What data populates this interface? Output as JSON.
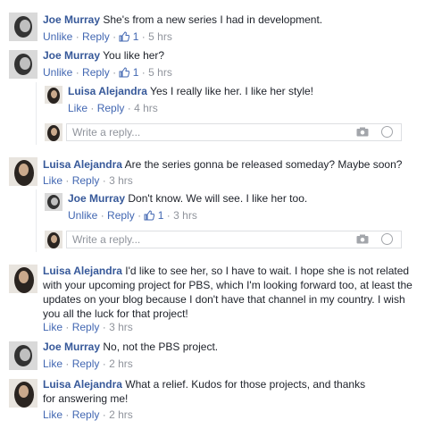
{
  "comments": [
    {
      "author": "Joe Murray",
      "text": "She's from a new series I had in development.",
      "unlike": "Unlike",
      "reply": "Reply",
      "likes": "1",
      "time": "5 hrs"
    },
    {
      "author": "Joe Murray",
      "text": "You like her?",
      "unlike": "Unlike",
      "reply": "Reply",
      "likes": "1",
      "time": "5 hrs"
    },
    {
      "author": "Luisa Alejandra",
      "text": "Yes I really like her. I like her style!",
      "like": "Like",
      "reply": "Reply",
      "time": "4 hrs"
    },
    {
      "author": "Luisa Alejandra",
      "text": "Are the series gonna be released someday? Maybe soon?",
      "like": "Like",
      "reply": "Reply",
      "time": "3 hrs"
    },
    {
      "author": "Joe Murray",
      "text": "Don't know. We will see. I like her too.",
      "unlike": "Unlike",
      "reply": "Reply",
      "likes": "1",
      "time": "3 hrs"
    },
    {
      "author": "Luisa Alejandra",
      "text": "I'd like to see her, so I have to wait. I hope she is not related with your upcoming project for PBS, which I'm looking forward too, at least the updates on your blog because I don't have that channel in my country. I wish you all the luck for that project!",
      "like": "Like",
      "reply": "Reply",
      "time": "3 hrs"
    },
    {
      "author": "Joe Murray",
      "text": "No, not the PBS project.",
      "like": "Like",
      "reply": "Reply",
      "time": "2 hrs"
    },
    {
      "author": "Luisa Alejandra",
      "text": "What a relief. Kudos for those projects, and thanks for answering me!",
      "like": "Like",
      "reply": "Reply",
      "time": "2 hrs"
    }
  ],
  "reply_box": {
    "placeholder": "Write a reply..."
  },
  "icons": {
    "like": "thumbs-up-icon",
    "camera": "camera-icon",
    "emoji": "emoji-icon"
  },
  "colors": {
    "link": "#4267b2",
    "name": "#365899",
    "meta": "#90949c"
  }
}
